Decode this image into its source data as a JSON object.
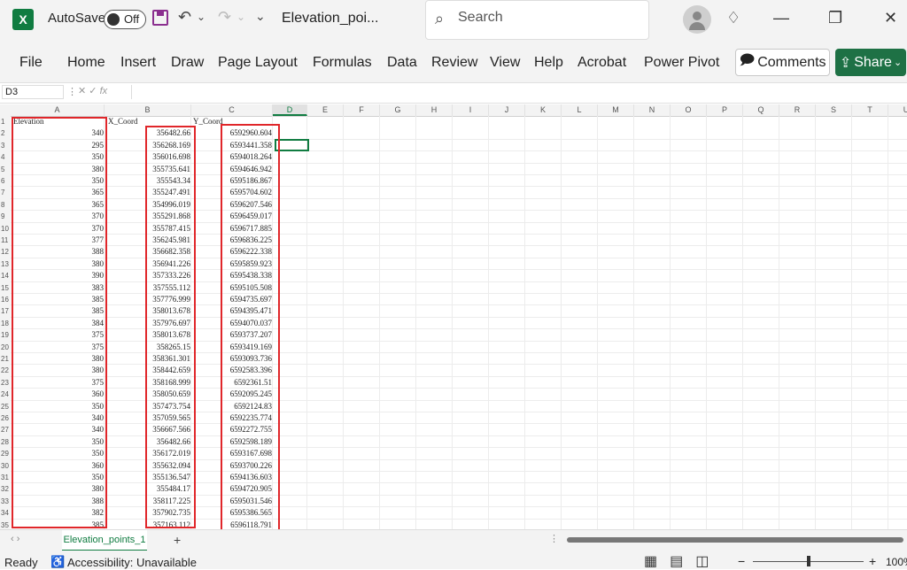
{
  "titlebar": {
    "app_logo": "X",
    "autosave_label": "AutoSave",
    "autosave_state": "Off",
    "undo_glyph": "↶",
    "redo_glyph": "↷",
    "customize_glyph": "⌄",
    "title": "Elevation_poi...",
    "search_placeholder": "Search",
    "minimize_glyph": "—",
    "restore_glyph": "❐",
    "close_glyph": "✕",
    "lightbulb_glyph": "♢"
  },
  "ribbon": {
    "tabs": [
      "File",
      "Home",
      "Insert",
      "Draw",
      "Page Layout",
      "Formulas",
      "Data",
      "Review",
      "View",
      "Help",
      "Acrobat",
      "Power Pivot"
    ],
    "comments_label": "Comments",
    "share_label": "Share"
  },
  "formula_bar": {
    "name_box": "D3",
    "fx": "fx"
  },
  "grid": {
    "columns": [
      "A",
      "B",
      "C",
      "D",
      "E",
      "F",
      "G",
      "H",
      "I",
      "J",
      "K",
      "L",
      "M",
      "N",
      "O",
      "P",
      "Q",
      "R",
      "S",
      "T",
      "U"
    ],
    "selected_column": "D",
    "header_row": {
      "row": "1",
      "a": "Elevation",
      "b": "X_Coord",
      "c": "Y_Coord"
    },
    "rows": [
      {
        "n": "2",
        "a": "340",
        "b": "356482.66",
        "c": "6592960.604"
      },
      {
        "n": "3",
        "a": "295",
        "b": "356268.169",
        "c": "6593441.358"
      },
      {
        "n": "4",
        "a": "350",
        "b": "356016.698",
        "c": "6594018.264"
      },
      {
        "n": "5",
        "a": "380",
        "b": "355735.641",
        "c": "6594646.942"
      },
      {
        "n": "6",
        "a": "350",
        "b": "355543.34",
        "c": "6595186.867"
      },
      {
        "n": "7",
        "a": "365",
        "b": "355247.491",
        "c": "6595704.602"
      },
      {
        "n": "8",
        "a": "365",
        "b": "354996.019",
        "c": "6596207.546"
      },
      {
        "n": "9",
        "a": "370",
        "b": "355291.868",
        "c": "6596459.017"
      },
      {
        "n": "10",
        "a": "370",
        "b": "355787.415",
        "c": "6596717.885"
      },
      {
        "n": "11",
        "a": "377",
        "b": "356245.981",
        "c": "6596836.225"
      },
      {
        "n": "12",
        "a": "388",
        "b": "356682.358",
        "c": "6596222.338"
      },
      {
        "n": "13",
        "a": "380",
        "b": "356941.226",
        "c": "6595859.923"
      },
      {
        "n": "14",
        "a": "390",
        "b": "357333.226",
        "c": "6595438.338"
      },
      {
        "n": "15",
        "a": "383",
        "b": "357555.112",
        "c": "6595105.508"
      },
      {
        "n": "16",
        "a": "385",
        "b": "357776.999",
        "c": "6594735.697"
      },
      {
        "n": "17",
        "a": "385",
        "b": "358013.678",
        "c": "6594395.471"
      },
      {
        "n": "18",
        "a": "384",
        "b": "357976.697",
        "c": "6594070.037"
      },
      {
        "n": "19",
        "a": "375",
        "b": "358013.678",
        "c": "6593737.207"
      },
      {
        "n": "20",
        "a": "375",
        "b": "358265.15",
        "c": "6593419.169"
      },
      {
        "n": "21",
        "a": "380",
        "b": "358361.301",
        "c": "6593093.736"
      },
      {
        "n": "22",
        "a": "380",
        "b": "358442.659",
        "c": "6592583.396"
      },
      {
        "n": "23",
        "a": "375",
        "b": "358168.999",
        "c": "6592361.51"
      },
      {
        "n": "24",
        "a": "360",
        "b": "358050.659",
        "c": "6592095.245"
      },
      {
        "n": "25",
        "a": "350",
        "b": "357473.754",
        "c": "6592124.83"
      },
      {
        "n": "26",
        "a": "340",
        "b": "357059.565",
        "c": "6592235.774"
      },
      {
        "n": "27",
        "a": "340",
        "b": "356667.566",
        "c": "6592272.755"
      },
      {
        "n": "28",
        "a": "350",
        "b": "356482.66",
        "c": "6592598.189"
      },
      {
        "n": "29",
        "a": "350",
        "b": "356172.019",
        "c": "6593167.698"
      },
      {
        "n": "30",
        "a": "360",
        "b": "355632.094",
        "c": "6593700.226"
      },
      {
        "n": "31",
        "a": "350",
        "b": "355136.547",
        "c": "6594136.603"
      },
      {
        "n": "32",
        "a": "380",
        "b": "355484.17",
        "c": "6594720.905"
      },
      {
        "n": "33",
        "a": "388",
        "b": "358117.225",
        "c": "6595031.546"
      },
      {
        "n": "34",
        "a": "382",
        "b": "357902.735",
        "c": "6595386.565"
      },
      {
        "n": "35",
        "a": "385",
        "b": "357163.112",
        "c": "6596118.791"
      }
    ]
  },
  "sheets": {
    "active": "Elevation_points_1",
    "add_glyph": "+",
    "nav_glyph": "‹  ›"
  },
  "status": {
    "ready": "Ready",
    "accessibility": "Accessibility: Unavailable",
    "zoom": "100%"
  },
  "colors": {
    "excel_green": "#107c41",
    "share_green": "#1e7145",
    "highlight_red": "#e0262a"
  }
}
